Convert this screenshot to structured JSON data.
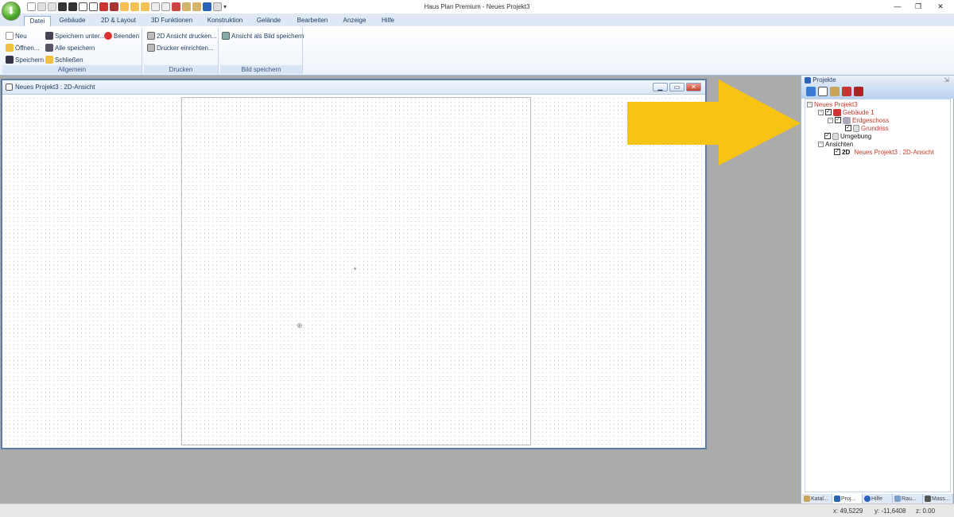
{
  "window": {
    "title": "Haus Plan Premium - Neues Projekt3",
    "minimize": "—",
    "restore": "❐",
    "close": "✕"
  },
  "tabs": [
    "Datei",
    "Gebäude",
    "2D & Layout",
    "3D Funktionen",
    "Konstruktion",
    "Gelände",
    "Bearbeiten",
    "Anzeige",
    "Hilfe"
  ],
  "ribbon": {
    "allgemein": {
      "label": "Allgemein",
      "neu": "Neu",
      "oeffnen": "Öffnen...",
      "speichern": "Speichern",
      "speichern_unter": "Speichern unter...",
      "alle_speichern": "Alle speichern",
      "schliessen": "Schließen",
      "beenden": "Beenden"
    },
    "drucken": {
      "label": "Drucken",
      "ansicht_drucken": "2D Ansicht drucken...",
      "drucker_einrichten": "Drucker einrichten..."
    },
    "bild_speichern": {
      "label": "Bild speichern",
      "ansicht_als_bild": "Ansicht als Bild speichern"
    }
  },
  "document": {
    "title": "Neues Projekt3 : 2D-Ansicht"
  },
  "projects_panel": {
    "title": "Projekte",
    "tree": {
      "project": "Neues Projekt3",
      "building": "Gebäude 1",
      "floor": "Erdgeschoss",
      "plan": "Grundriss",
      "surroundings": "Umgebung",
      "views": "Ansichten",
      "view_tag": "2D",
      "view": "Neues Projekt3 : 2D-Ansicht"
    }
  },
  "panel_tabs": [
    "Katal...",
    "Proj...",
    "Hilfe",
    "Rau...",
    "Mass..."
  ],
  "status": {
    "x": "x: 49,5229",
    "y": "y: -11,6408",
    "z": "z: 0.00"
  },
  "colors": {
    "accent_arrow": "#f7c315",
    "tree_red": "#c0392b",
    "ribbon_blue": "#dfe9f5"
  }
}
